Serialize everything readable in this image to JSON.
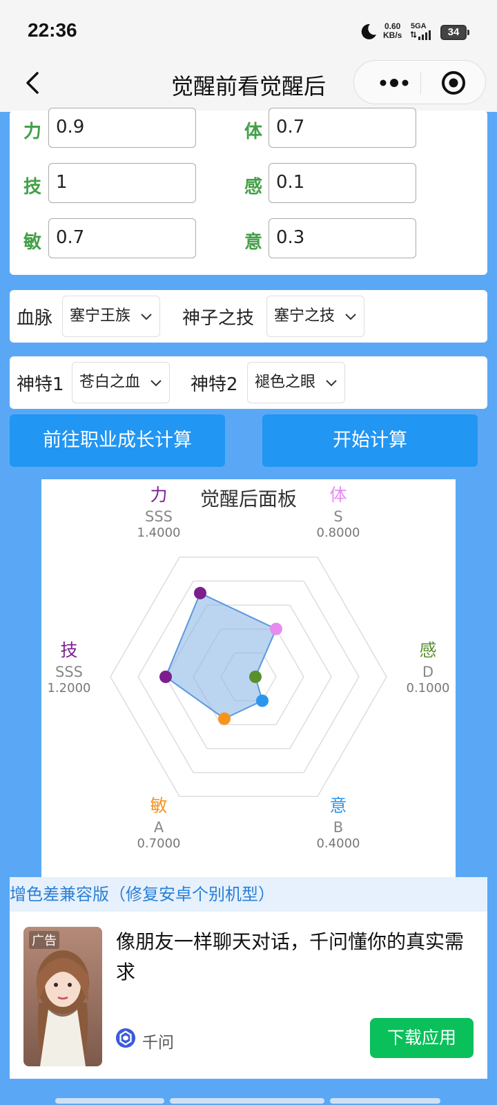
{
  "status_bar": {
    "time": "22:36",
    "net_speed": "0.60",
    "net_unit": "KB/s",
    "net_type": "5GA",
    "battery": "34"
  },
  "nav": {
    "title": "觉醒前看觉醒后"
  },
  "stats": {
    "rows": [
      {
        "left_label": "力",
        "left_value": "0.9",
        "right_label": "体",
        "right_value": "0.7"
      },
      {
        "left_label": "技",
        "left_value": "1",
        "right_label": "感",
        "right_value": "0.1"
      },
      {
        "left_label": "敏",
        "left_value": "0.7",
        "right_label": "意",
        "right_value": "0.3"
      }
    ]
  },
  "bloodline": {
    "label": "血脉",
    "value": "塞宁王族",
    "skill_label": "神子之技",
    "skill_value": "塞宁之技"
  },
  "traits": {
    "label1": "神特1",
    "value1": "苍白之血",
    "label2": "神特2",
    "value2": "褪色之眼"
  },
  "buttons": {
    "career": "前往职业成长计算",
    "calculate": "开始计算"
  },
  "chart_data": {
    "type": "radar",
    "title": "觉醒后面板",
    "axes": [
      {
        "name": "力",
        "grade": "SSS",
        "value": 1.4,
        "value_label": "1.4000",
        "color": "#7b1f8f"
      },
      {
        "name": "体",
        "grade": "S",
        "value": 0.8,
        "value_label": "0.8000",
        "color": "#e68cf0"
      },
      {
        "name": "感",
        "grade": "D",
        "value": 0.1,
        "value_label": "0.1000",
        "color": "#5a8f2e"
      },
      {
        "name": "意",
        "grade": "B",
        "value": 0.4,
        "value_label": "0.4000",
        "color": "#2c96ee"
      },
      {
        "name": "敏",
        "grade": "A",
        "value": 0.7,
        "value_label": "0.7000",
        "color": "#f7941d"
      },
      {
        "name": "技",
        "grade": "SSS",
        "value": 1.2,
        "value_label": "1.2000",
        "color": "#7b1f8f"
      }
    ],
    "max": 2.0,
    "rings": 5,
    "fill_color": "#8db9e8",
    "line_color": "#5a97dd"
  },
  "banner": {
    "text": "增色差兼容版（修复安卓个别机型）"
  },
  "ad": {
    "tag": "广告",
    "text": "像朋友一样聊天对话，千问懂你的真实需求",
    "brand": "千问",
    "button": "下载应用"
  }
}
